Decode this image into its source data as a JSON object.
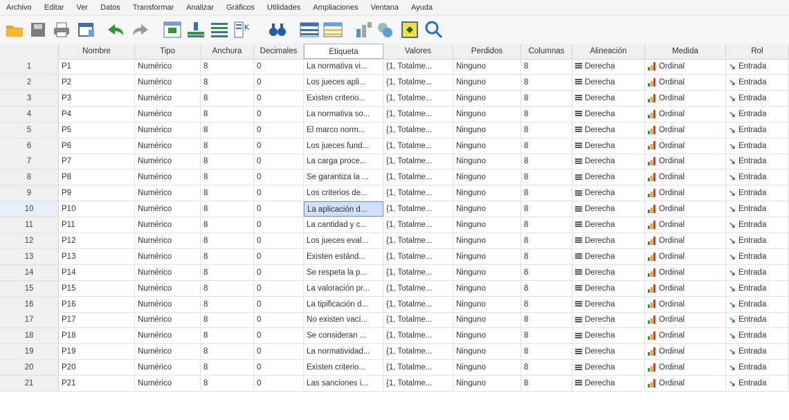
{
  "menu": [
    "Archivo",
    "Editar",
    "Ver",
    "Datos",
    "Transformar",
    "Analizar",
    "Gráficos",
    "Utilidades",
    "Ampliaciones",
    "Ventana",
    "Ayuda"
  ],
  "toolbar_icons": [
    "open-folder-icon",
    "save-icon",
    "print-icon",
    "dialog-recall-icon",
    "undo-icon",
    "redo-icon",
    "go-to-case-icon",
    "go-to-variable-icon",
    "variables-icon",
    "find-icon",
    "insert-cases-icon",
    "insert-variable-icon",
    "split-file-icon",
    "select-cases-icon",
    "value-labels-icon",
    "search-icon"
  ],
  "columns": [
    "Nombre",
    "Tipo",
    "Anchura",
    "Decimales",
    "Etiqueta",
    "Valores",
    "Perdidos",
    "Columnas",
    "Alineación",
    "Medida",
    "Rol"
  ],
  "selected_row": 10,
  "colors": {
    "accent": "#2f6fd1",
    "selection": "#cfe0f7",
    "folder": "#f0a020",
    "undo": "#2e9a2e"
  },
  "rows": [
    {
      "n": "1",
      "nombre": "P1",
      "tipo": "Numérico",
      "anchura": "8",
      "decimales": "0",
      "etiqueta": "La normativa vi...",
      "valores": "{1, Totalme...",
      "perdidos": "Ninguno",
      "columnas": "8",
      "alineacion": "Derecha",
      "medida": "Ordinal",
      "rol": "Entrada"
    },
    {
      "n": "2",
      "nombre": "P2",
      "tipo": "Numérico",
      "anchura": "8",
      "decimales": "0",
      "etiqueta": "Los jueces apli...",
      "valores": "{1, Totalme...",
      "perdidos": "Ninguno",
      "columnas": "8",
      "alineacion": "Derecha",
      "medida": "Ordinal",
      "rol": "Entrada"
    },
    {
      "n": "3",
      "nombre": "P3",
      "tipo": "Numérico",
      "anchura": "8",
      "decimales": "0",
      "etiqueta": "Existen criterio...",
      "valores": "{1, Totalme...",
      "perdidos": "Ninguno",
      "columnas": "8",
      "alineacion": "Derecha",
      "medida": "Ordinal",
      "rol": "Entrada"
    },
    {
      "n": "4",
      "nombre": "P4",
      "tipo": "Numérico",
      "anchura": "8",
      "decimales": "0",
      "etiqueta": "La normativa so...",
      "valores": "{1, Totalme...",
      "perdidos": "Ninguno",
      "columnas": "8",
      "alineacion": "Derecha",
      "medida": "Ordinal",
      "rol": "Entrada"
    },
    {
      "n": "5",
      "nombre": "P5",
      "tipo": "Numérico",
      "anchura": "8",
      "decimales": "0",
      "etiqueta": "El marco norm...",
      "valores": "{1, Totalme...",
      "perdidos": "Ninguno",
      "columnas": "8",
      "alineacion": "Derecha",
      "medida": "Ordinal",
      "rol": "Entrada"
    },
    {
      "n": "6",
      "nombre": "P6",
      "tipo": "Numérico",
      "anchura": "8",
      "decimales": "0",
      "etiqueta": "Los jueces fund...",
      "valores": "{1, Totalme...",
      "perdidos": "Ninguno",
      "columnas": "8",
      "alineacion": "Derecha",
      "medida": "Ordinal",
      "rol": "Entrada"
    },
    {
      "n": "7",
      "nombre": "P7",
      "tipo": "Numérico",
      "anchura": "8",
      "decimales": "0",
      "etiqueta": "La carga proce...",
      "valores": "{1, Totalme...",
      "perdidos": "Ninguno",
      "columnas": "8",
      "alineacion": "Derecha",
      "medida": "Ordinal",
      "rol": "Entrada"
    },
    {
      "n": "8",
      "nombre": "P8",
      "tipo": "Numérico",
      "anchura": "8",
      "decimales": "0",
      "etiqueta": "Se garantiza la ...",
      "valores": "{1, Totalme...",
      "perdidos": "Ninguno",
      "columnas": "8",
      "alineacion": "Derecha",
      "medida": "Ordinal",
      "rol": "Entrada"
    },
    {
      "n": "9",
      "nombre": "P9",
      "tipo": "Numérico",
      "anchura": "8",
      "decimales": "0",
      "etiqueta": "Los criterios de...",
      "valores": "{1, Totalme...",
      "perdidos": "Ninguno",
      "columnas": "8",
      "alineacion": "Derecha",
      "medida": "Ordinal",
      "rol": "Entrada"
    },
    {
      "n": "10",
      "nombre": "P10",
      "tipo": "Numérico",
      "anchura": "8",
      "decimales": "0",
      "etiqueta": "La aplicación d...",
      "valores": "{1, Totalme...",
      "perdidos": "Ninguno",
      "columnas": "8",
      "alineacion": "Derecha",
      "medida": "Ordinal",
      "rol": "Entrada"
    },
    {
      "n": "11",
      "nombre": "P11",
      "tipo": "Numérico",
      "anchura": "8",
      "decimales": "0",
      "etiqueta": "La cantidad y c...",
      "valores": "{1, Totalme...",
      "perdidos": "Ninguno",
      "columnas": "8",
      "alineacion": "Derecha",
      "medida": "Ordinal",
      "rol": "Entrada"
    },
    {
      "n": "12",
      "nombre": "P12",
      "tipo": "Numérico",
      "anchura": "8",
      "decimales": "0",
      "etiqueta": "Los jueces eval...",
      "valores": "{1, Totalme...",
      "perdidos": "Ninguno",
      "columnas": "8",
      "alineacion": "Derecha",
      "medida": "Ordinal",
      "rol": "Entrada"
    },
    {
      "n": "13",
      "nombre": "P13",
      "tipo": "Numérico",
      "anchura": "8",
      "decimales": "0",
      "etiqueta": "Existen estánd...",
      "valores": "{1, Totalme...",
      "perdidos": "Ninguno",
      "columnas": "8",
      "alineacion": "Derecha",
      "medida": "Ordinal",
      "rol": "Entrada"
    },
    {
      "n": "14",
      "nombre": "P14",
      "tipo": "Numérico",
      "anchura": "8",
      "decimales": "0",
      "etiqueta": "Se respeta la p...",
      "valores": "{1, Totalme...",
      "perdidos": "Ninguno",
      "columnas": "8",
      "alineacion": "Derecha",
      "medida": "Ordinal",
      "rol": "Entrada"
    },
    {
      "n": "15",
      "nombre": "P15",
      "tipo": "Numérico",
      "anchura": "8",
      "decimales": "0",
      "etiqueta": "La valoración pr...",
      "valores": "{1, Totalme...",
      "perdidos": "Ninguno",
      "columnas": "8",
      "alineacion": "Derecha",
      "medida": "Ordinal",
      "rol": "Entrada"
    },
    {
      "n": "16",
      "nombre": "P16",
      "tipo": "Numérico",
      "anchura": "8",
      "decimales": "0",
      "etiqueta": "La tipificación d...",
      "valores": "{1, Totalme...",
      "perdidos": "Ninguno",
      "columnas": "8",
      "alineacion": "Derecha",
      "medida": "Ordinal",
      "rol": "Entrada"
    },
    {
      "n": "17",
      "nombre": "P17",
      "tipo": "Numérico",
      "anchura": "8",
      "decimales": "0",
      "etiqueta": "No existen vací...",
      "valores": "{1, Totalme...",
      "perdidos": "Ninguno",
      "columnas": "8",
      "alineacion": "Derecha",
      "medida": "Ordinal",
      "rol": "Entrada"
    },
    {
      "n": "18",
      "nombre": "P18",
      "tipo": "Numérico",
      "anchura": "8",
      "decimales": "0",
      "etiqueta": "Se consideran ...",
      "valores": "{1, Totalme...",
      "perdidos": "Ninguno",
      "columnas": "8",
      "alineacion": "Derecha",
      "medida": "Ordinal",
      "rol": "Entrada"
    },
    {
      "n": "19",
      "nombre": "P19",
      "tipo": "Numérico",
      "anchura": "8",
      "decimales": "0",
      "etiqueta": "La normatividad...",
      "valores": "{1, Totalme...",
      "perdidos": "Ninguno",
      "columnas": "8",
      "alineacion": "Derecha",
      "medida": "Ordinal",
      "rol": "Entrada"
    },
    {
      "n": "20",
      "nombre": "P20",
      "tipo": "Numérico",
      "anchura": "8",
      "decimales": "0",
      "etiqueta": "Existen criterio...",
      "valores": "{1, Totalme...",
      "perdidos": "Ninguno",
      "columnas": "8",
      "alineacion": "Derecha",
      "medida": "Ordinal",
      "rol": "Entrada"
    },
    {
      "n": "21",
      "nombre": "P21",
      "tipo": "Numérico",
      "anchura": "8",
      "decimales": "0",
      "etiqueta": "Las sanciones i...",
      "valores": "{1, Totalme...",
      "perdidos": "Ninguno",
      "columnas": "8",
      "alineacion": "Derecha",
      "medida": "Ordinal",
      "rol": "Entrada"
    }
  ]
}
